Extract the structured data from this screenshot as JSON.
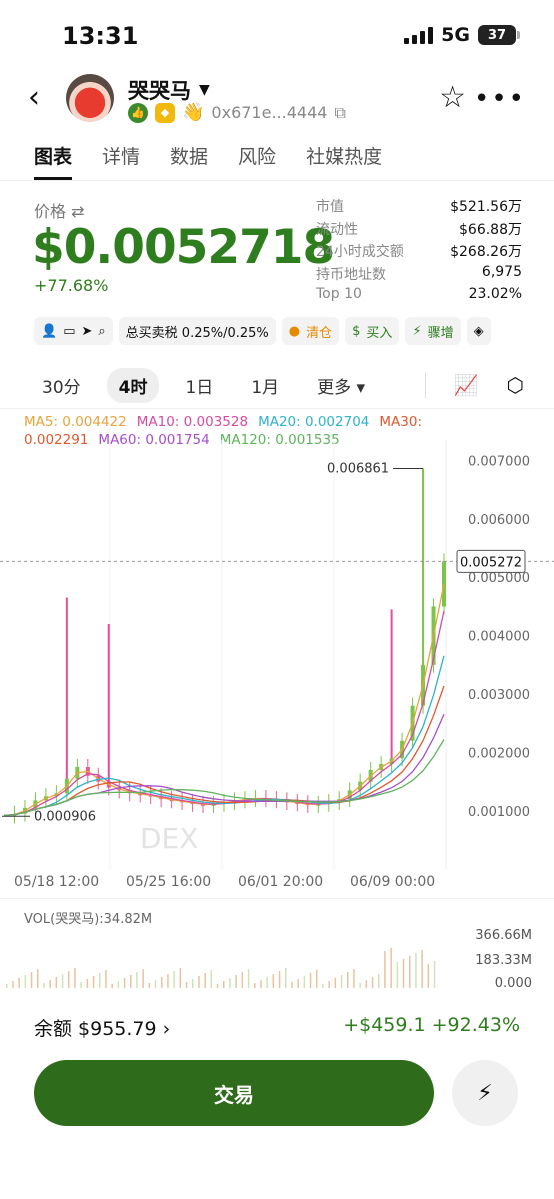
{
  "status_bar": {
    "time": "13:31",
    "network": "5G",
    "battery": "37"
  },
  "header": {
    "token_name": "哭哭马",
    "address": "0x671e...4444"
  },
  "tabs": [
    {
      "label": "图表",
      "active": true
    },
    {
      "label": "详情",
      "active": false
    },
    {
      "label": "数据",
      "active": false
    },
    {
      "label": "风险",
      "active": false
    },
    {
      "label": "社媒热度",
      "active": false
    }
  ],
  "price": {
    "label": "价格",
    "value": "$0.0052718",
    "change": "+77.68%"
  },
  "stats": [
    {
      "k": "市值",
      "v": "$521.56万"
    },
    {
      "k": "流动性",
      "v": "$66.88万"
    },
    {
      "k": "24小时成交额",
      "v": "$268.26万"
    },
    {
      "k": "持币地址数",
      "v": "6,975"
    },
    {
      "k": "Top 10",
      "v": "23.02%"
    }
  ],
  "toolbar": {
    "tax": "总买卖税 0.25%/0.25%",
    "clear": "清仓",
    "buy": "买入",
    "surge": "骤增"
  },
  "timeframes": {
    "items": [
      "30分",
      "4时",
      "1日",
      "1月"
    ],
    "active": "4时",
    "more": "更多"
  },
  "ma_legend": [
    {
      "text": "MA5: 0.004422",
      "color": "#e8a33c"
    },
    {
      "text": "MA10: 0.003528",
      "color": "#d64ba0"
    },
    {
      "text": "MA20: 0.002704",
      "color": "#2eb3c9"
    },
    {
      "text": "MA30: 0.002291",
      "color": "#e0582e"
    },
    {
      "text": "MA60: 0.001754",
      "color": "#a64fc9"
    },
    {
      "text": "MA120: 0.001535",
      "color": "#5fb35f"
    }
  ],
  "chart_data": {
    "type": "line",
    "title": "",
    "y_ticks": [
      "0.007000",
      "0.006000",
      "0.005000",
      "0.004000",
      "0.003000",
      "0.002000",
      "0.001000"
    ],
    "y_range": [
      0.0005,
      0.00735
    ],
    "x_ticks": [
      "05/18 12:00",
      "05/25 16:00",
      "06/01 20:00",
      "06/09 00:00"
    ],
    "high_label": "0.006861",
    "low_label": "0.000906",
    "current_label": "0.005272",
    "watermark": "DEX",
    "close_series": [
      0.00092,
      0.00095,
      0.00105,
      0.00118,
      0.00125,
      0.0013,
      0.00155,
      0.00175,
      0.0016,
      0.0015,
      0.0014,
      0.00135,
      0.0013,
      0.00128,
      0.00125,
      0.0012,
      0.00118,
      0.00115,
      0.00112,
      0.0011,
      0.00112,
      0.00115,
      0.00118,
      0.0012,
      0.00122,
      0.0012,
      0.00118,
      0.00115,
      0.00113,
      0.0011,
      0.00112,
      0.00115,
      0.0012,
      0.00135,
      0.0015,
      0.0017,
      0.0018,
      0.0019,
      0.0022,
      0.0028,
      0.0035,
      0.0045,
      0.0052718
    ],
    "spikes": [
      {
        "index": 6,
        "high": 0.00465
      },
      {
        "index": 10,
        "high": 0.0042
      },
      {
        "index": 37,
        "high": 0.00445
      },
      {
        "index": 40,
        "high": 0.006861
      }
    ],
    "vol_label": "VOL(哭哭马):34.82M",
    "vol_ticks": [
      "366.66M",
      "183.33M",
      "0.000"
    ]
  },
  "footer": {
    "balance": "余额 $955.79",
    "pnl": "+$459.1 +92.43%",
    "trade_label": "交易"
  },
  "colors": {
    "accent": "#2e7d1e",
    "button": "#2e6b1a"
  }
}
